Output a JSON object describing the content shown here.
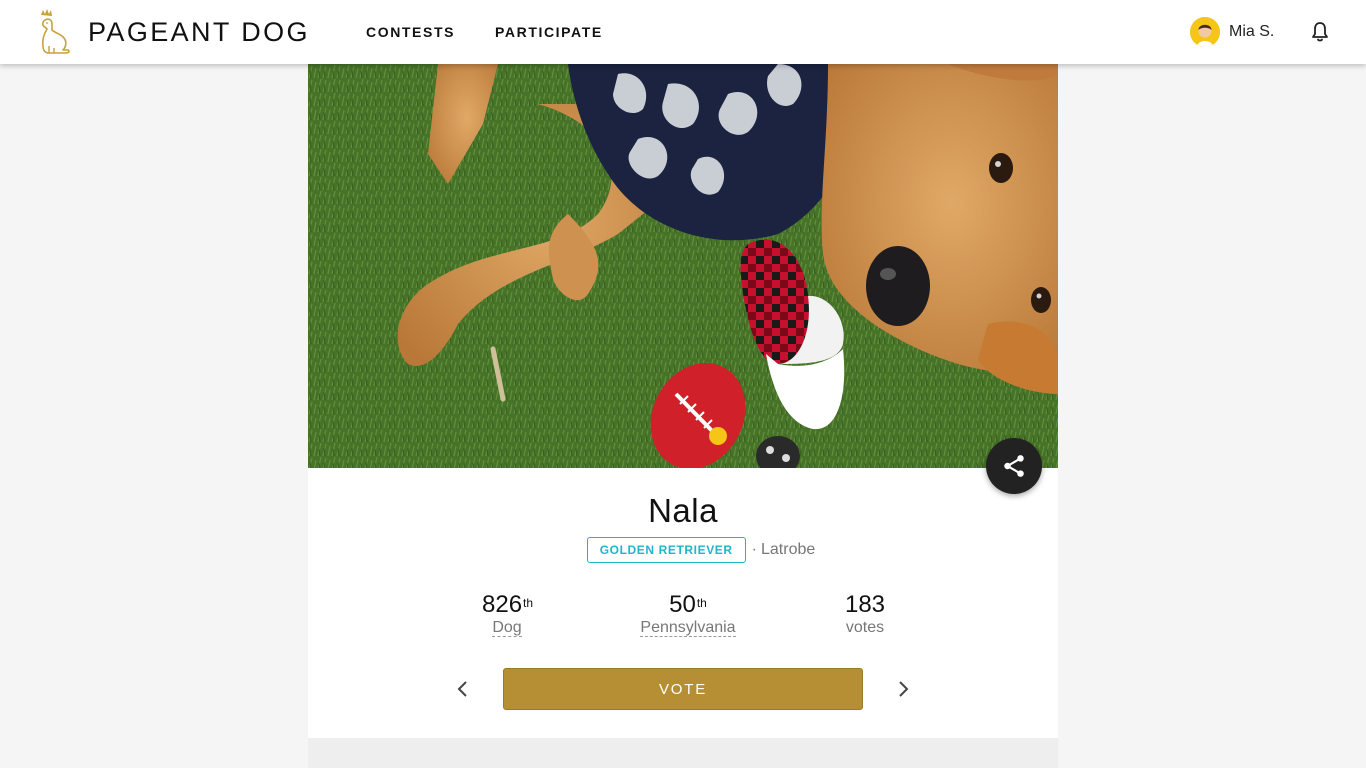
{
  "header": {
    "logo_text": "PAGEANT DOG",
    "nav": {
      "contests": "CONTESTS",
      "participate": "PARTICIPATE"
    },
    "user_name": "Mia S."
  },
  "dog": {
    "name": "Nala",
    "breed": "GOLDEN RETRIEVER",
    "separator": "·",
    "city": "Latrobe"
  },
  "stats": {
    "dog_rank": {
      "value": "826",
      "suffix": "th",
      "label": "Dog"
    },
    "state_rank": {
      "value": "50",
      "suffix": "th",
      "label": "Pennsylvania"
    },
    "votes": {
      "value": "183",
      "label": "votes"
    }
  },
  "actions": {
    "vote_label": "VOTE"
  },
  "colors": {
    "brand_gold": "#b68f35",
    "breed_badge": "#1fb6c9",
    "share_button": "#222222"
  },
  "icons": {
    "logo": "dog-crown-icon",
    "notifications": "bell-icon",
    "share": "share-icon",
    "prev": "chevron-left-icon",
    "next": "chevron-right-icon"
  }
}
